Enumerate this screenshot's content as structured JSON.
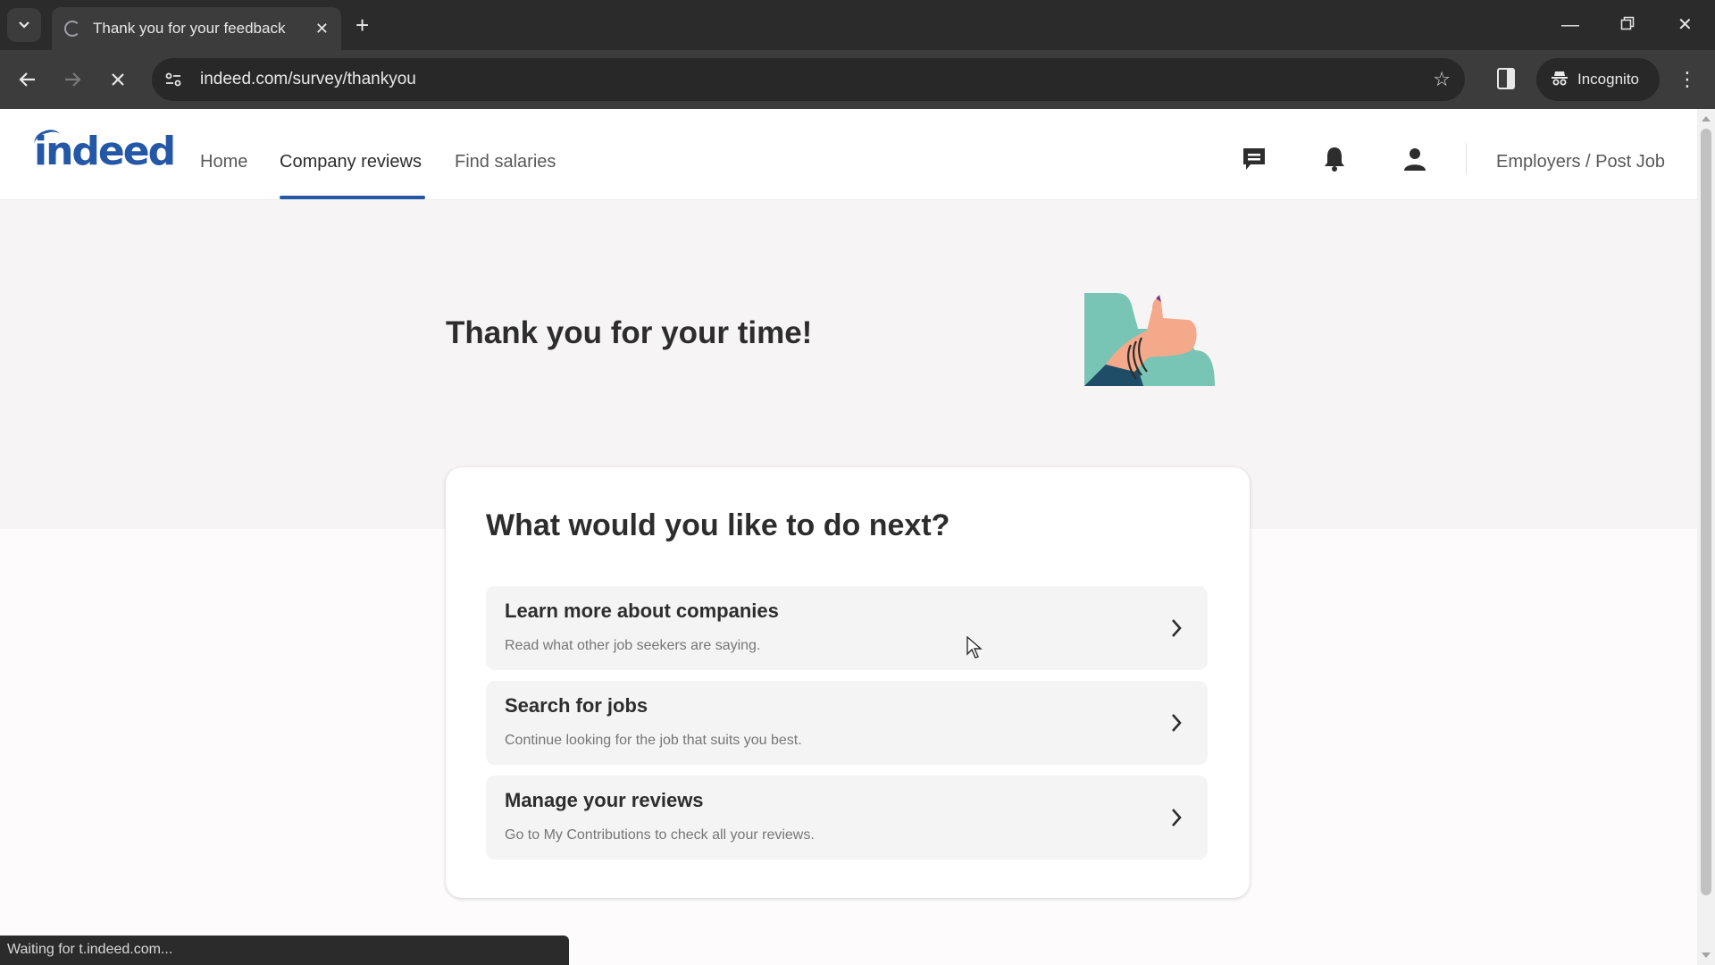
{
  "browser": {
    "tab_title": "Thank you for your feedback",
    "url": "indeed.com/survey/thankyou",
    "incognito_label": "Incognito",
    "status_text": "Waiting for t.indeed.com..."
  },
  "header": {
    "logo_text": "indeed",
    "nav": [
      {
        "label": "Home",
        "active": false
      },
      {
        "label": "Company reviews",
        "active": true
      },
      {
        "label": "Find salaries",
        "active": false
      }
    ],
    "icons": [
      "messages-icon",
      "notifications-bell-icon",
      "account-icon"
    ],
    "employers_link": "Employers / Post Job",
    "brand_color": "#2557a7"
  },
  "hero": {
    "title": "Thank you for your time!",
    "illustration": "thumbs-up-illustration"
  },
  "next_steps": {
    "title": "What would you like to do next?",
    "options": [
      {
        "title": "Learn more about companies",
        "description": "Read what other job seekers are saying."
      },
      {
        "title": "Search for jobs",
        "description": "Continue looking for the job that suits you best."
      },
      {
        "title": "Manage your reviews",
        "description": "Go to My Contributions to check all your reviews."
      }
    ]
  }
}
